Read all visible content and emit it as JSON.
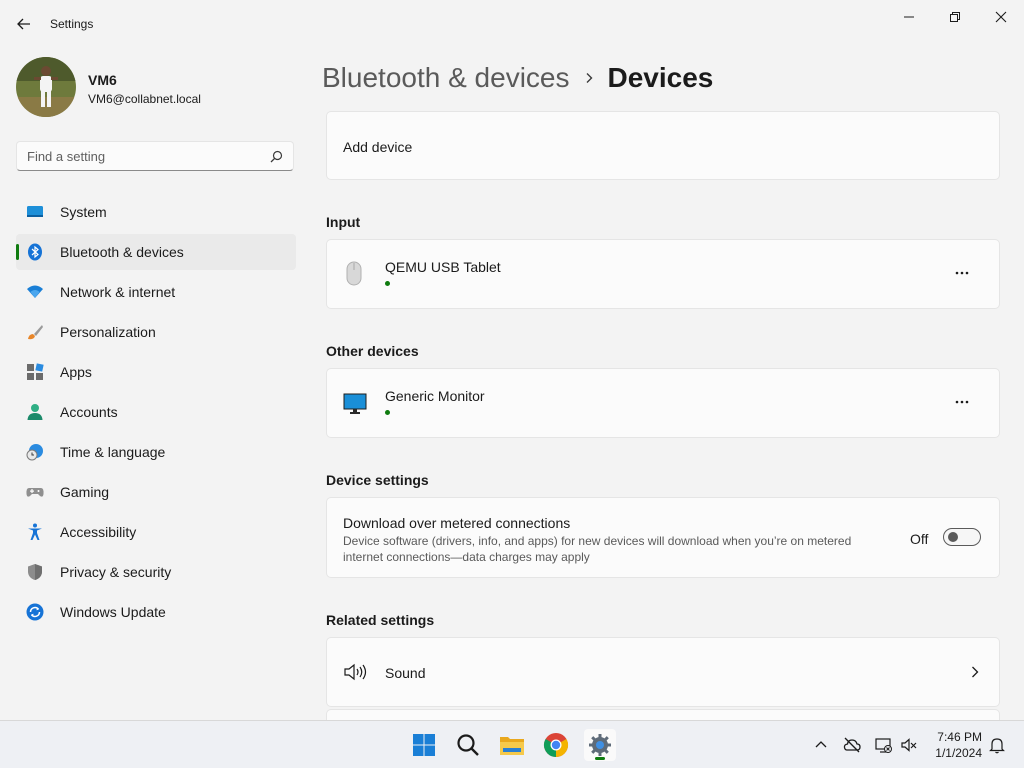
{
  "window": {
    "app_title": "Settings"
  },
  "profile": {
    "name": "VM6",
    "email": "VM6@collabnet.local"
  },
  "search": {
    "placeholder": "Find a setting"
  },
  "nav": {
    "items": [
      {
        "label": "System",
        "icon": "system-icon"
      },
      {
        "label": "Bluetooth & devices",
        "icon": "bluetooth-icon",
        "selected": true
      },
      {
        "label": "Network & internet",
        "icon": "wifi-icon"
      },
      {
        "label": "Personalization",
        "icon": "brush-icon"
      },
      {
        "label": "Apps",
        "icon": "apps-icon"
      },
      {
        "label": "Accounts",
        "icon": "accounts-icon"
      },
      {
        "label": "Time & language",
        "icon": "time-language-icon"
      },
      {
        "label": "Gaming",
        "icon": "gamepad-icon"
      },
      {
        "label": "Accessibility",
        "icon": "accessibility-icon"
      },
      {
        "label": "Privacy & security",
        "icon": "shield-icon"
      },
      {
        "label": "Windows Update",
        "icon": "update-icon"
      }
    ]
  },
  "breadcrumb": {
    "parent": "Bluetooth & devices",
    "current": "Devices"
  },
  "main": {
    "add_device": "Add device",
    "input": {
      "title": "Input",
      "device_name": "QEMU USB Tablet",
      "icon": "mouse-icon",
      "status_color": "#0f7b0f"
    },
    "other_devices": {
      "title": "Other devices",
      "device_name": "Generic Monitor",
      "icon": "monitor-icon",
      "status_color": "#0f7b0f"
    },
    "device_settings": {
      "title": "Device settings",
      "setting_title": "Download over metered connections",
      "setting_desc_line1": "Device software (drivers, info, and apps) for new devices will download when you’re on metered",
      "setting_desc_line2": "internet connections—data charges may apply",
      "toggle_state": "Off",
      "toggle_on": false
    },
    "related": {
      "title": "Related settings",
      "sound_label": "Sound",
      "icon": "speaker-icon"
    }
  },
  "taskbar": {
    "apps": [
      "windows-start-icon",
      "search-icon",
      "file-explorer-icon",
      "chrome-icon",
      "settings-icon"
    ],
    "active_app": "settings-icon",
    "time": "7:46 PM",
    "date": "1/1/2024"
  },
  "colors": {
    "accent": "#0f7b0f",
    "background": "#f3f3f3",
    "card": "#fbfbfb"
  }
}
